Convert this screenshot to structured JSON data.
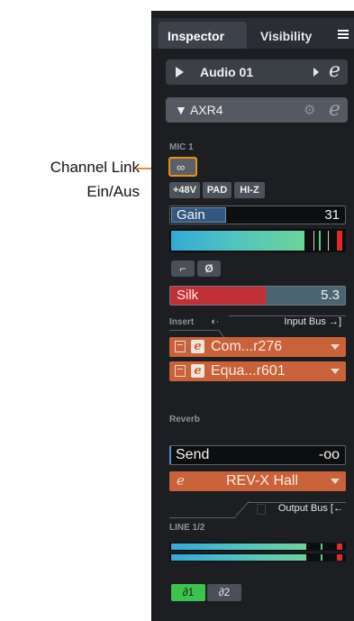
{
  "callout": {
    "line1": "Channel Link",
    "line2": "Ein/Aus"
  },
  "tabs": {
    "inspector": "Inspector",
    "visibility": "Visibility"
  },
  "track": {
    "name": "Audio 01",
    "edit_icon": "e"
  },
  "device": {
    "name": "▼ AXR4",
    "gear_icon": "⚙",
    "edit_icon": "e"
  },
  "mic": {
    "section_label": "MIC 1",
    "link_icon": "∞",
    "phantom": "+48V",
    "pad": "PAD",
    "hiz": "HI-Z",
    "gain_label": "Gain",
    "gain_value": "31",
    "gain_level": 0.32,
    "lowcut_icon": "⌐",
    "phase_icon": "Ø",
    "silk_label": "Silk",
    "silk_value": "5.3",
    "meter_level": 0.77
  },
  "insert": {
    "label": "Insert",
    "indicator": "◖·",
    "input_bus": "Input Bus →]",
    "slots": [
      {
        "name": "Com...r276",
        "edit_icon": "e"
      },
      {
        "name": "Equa...r601",
        "edit_icon": "e"
      }
    ]
  },
  "reverb": {
    "label": "Reverb",
    "send_label": "Send",
    "send_value": "-oo",
    "fx_icon": "e",
    "fx_name": "REV-X Hall",
    "output_bus": "Output Bus [←"
  },
  "line": {
    "label": "LINE 1/2",
    "monitor1": "∂1",
    "monitor2": "∂2"
  }
}
